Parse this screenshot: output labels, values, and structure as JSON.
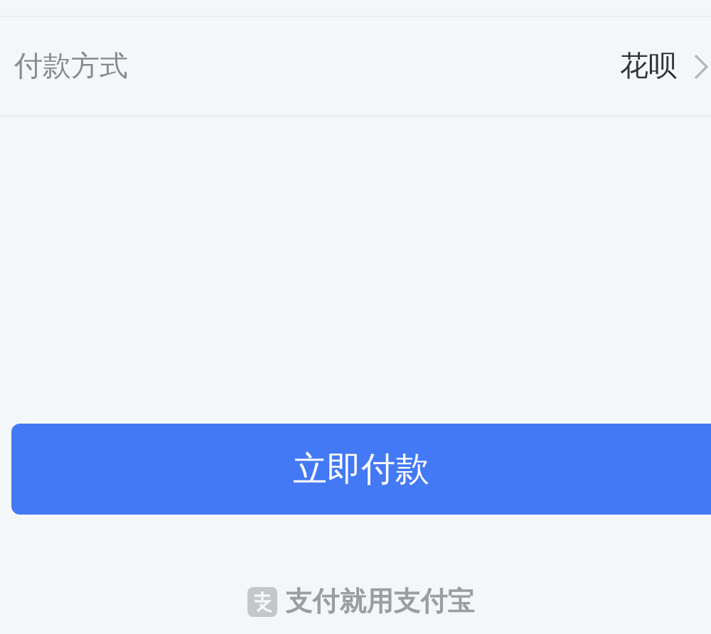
{
  "payment_method": {
    "label": "付款方式",
    "value": "花呗"
  },
  "pay_button": {
    "label": "立即付款"
  },
  "footer": {
    "slogan": "支付就用支付宝"
  }
}
